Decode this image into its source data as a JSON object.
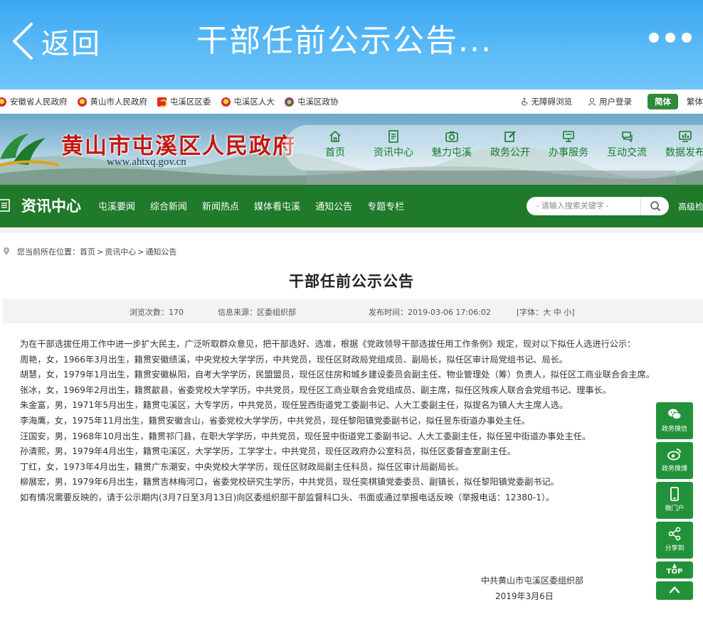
{
  "app": {
    "back_label": "返回",
    "title": "干部任前公示公告..."
  },
  "toplinks": [
    {
      "label": "安徽省人民政府",
      "icon": "national-emblem-icon"
    },
    {
      "label": "黄山市人民政府",
      "icon": "national-emblem-icon"
    },
    {
      "label": "屯溪区区委",
      "icon": "party-flag-icon"
    },
    {
      "label": "屯溪区人大",
      "icon": "national-emblem-icon"
    },
    {
      "label": "屯溪区政协",
      "icon": "cppcc-emblem-icon"
    }
  ],
  "topright": {
    "accessibility": "无障碍浏览",
    "login": "用户登录",
    "simplified": "简体",
    "traditional": "繁体"
  },
  "site": {
    "name": "黄山市屯溪区人民政府",
    "url": "www.ahtxq.gov.cn"
  },
  "nav": [
    {
      "label": "首页",
      "icon": "home-icon"
    },
    {
      "label": "资讯中心",
      "icon": "document-icon"
    },
    {
      "label": "魅力屯溪",
      "icon": "camera-icon"
    },
    {
      "label": "政务公开",
      "icon": "edit-icon"
    },
    {
      "label": "办事服务",
      "icon": "service-icon"
    },
    {
      "label": "互动交流",
      "icon": "chat-icon"
    },
    {
      "label": "数据发布",
      "icon": "data-icon"
    }
  ],
  "channel": {
    "title": "资讯中心",
    "links": [
      "屯溪要闻",
      "综合新闻",
      "新闻热点",
      "媒体看屯溪",
      "通知公告",
      "专题专栏"
    ],
    "search_placeholder": "- 请输入搜索关键字 -",
    "advanced": "高级检索"
  },
  "breadcrumb": {
    "prefix": "您当前所在位置：",
    "items": [
      "首页",
      "资讯中心",
      "通知公告"
    ],
    "sep": ">"
  },
  "article": {
    "title": "干部任前公示公告",
    "views_label": "浏览次数：",
    "views": "170",
    "source_label": "信息来源：",
    "source": "区委组织部",
    "time_label": "发布时间：",
    "time": "2019-03-06 17:06:02",
    "font_label": "[字体：",
    "font_large": "大",
    "font_mid": "中",
    "font_small": "小",
    "font_close": "]",
    "paragraphs": [
      "为在干部选拔任用工作中进一步扩大民主，广泛听取群众意见，把干部选好、选准，根据《党政领导干部选拔任用工作条例》规定，现对以下拟任人选进行公示：",
      "周艳，女，1966年3月出生，籍贯安徽绩溪，中央党校大学学历，中共党员，现任区财政局党组成员、副局长，拟任区审计局党组书记、局长。",
      "胡慧，女，1979年1月出生，籍贯安徽枞阳，自考大学学历，民盟盟员，现任区住房和城乡建设委员会副主任、物业管理处（筹）负责人，拟任区工商业联合会主席。",
      "张冰，女，1969年2月出生，籍贯歙县，省委党校大学学历，中共党员，现任区工商业联合会党组成员、副主席，拟任区残疾人联合会党组书记、理事长。",
      "朱金富，男，1971年5月出生，籍贯屯溪区，大专学历，中共党员，现任昱西街道党工委副书记、人大工委副主任，拟提名为镇人大主席人选。",
      "李海鹰，女，1975年11月出生，籍贯安徽含山，省委党校大学学历，中共党员，现任黎阳镇党委副书记，拟任昱东街道办事处主任。",
      "汪国安，男，1968年10月出生，籍贯祁门县，在职大学学历，中共党员，现任昱中街道党工委副书记、人大工委副主任，拟任昱中街道办事处主任。",
      "孙清熙，男，1979年4月出生，籍贯屯溪区，大学学历，工学学士，中共党员，现任区政府办公室科员，拟任区委督查室副主任。",
      "丁红，女，1973年4月出生，籍贯广东潮安，中央党校大学学历，现任区财政局副主任科员，拟任区审计局副局长。",
      "柳展宏，男，1979年6月出生，籍贯吉林梅河口，省委党校研究生学历，中共党员，现任奕棋镇党委委员、副镇长，拟任黎阳镇党委副书记。",
      "如有情况需要反映的，请于公示期内(3月7日至3月13日)向区委组织部干部监督科口头、书面或通过举报电话反映（举报电话：12380-1）。"
    ],
    "signature": "中共黄山市屯溪区委组织部",
    "date": "2019年3月6日"
  },
  "float": [
    {
      "label": "政务微信",
      "icon": "wechat-icon"
    },
    {
      "label": "政务微博",
      "icon": "weibo-icon"
    },
    {
      "label": "微门户",
      "icon": "mobile-icon"
    },
    {
      "label": "分享到",
      "icon": "share-icon"
    },
    {
      "label": "TOP",
      "icon": "top-icon"
    }
  ],
  "colors": {
    "header_blue": "#4bb1f4",
    "gov_green": "#1f7a2a",
    "title_red": "#c4170f"
  }
}
